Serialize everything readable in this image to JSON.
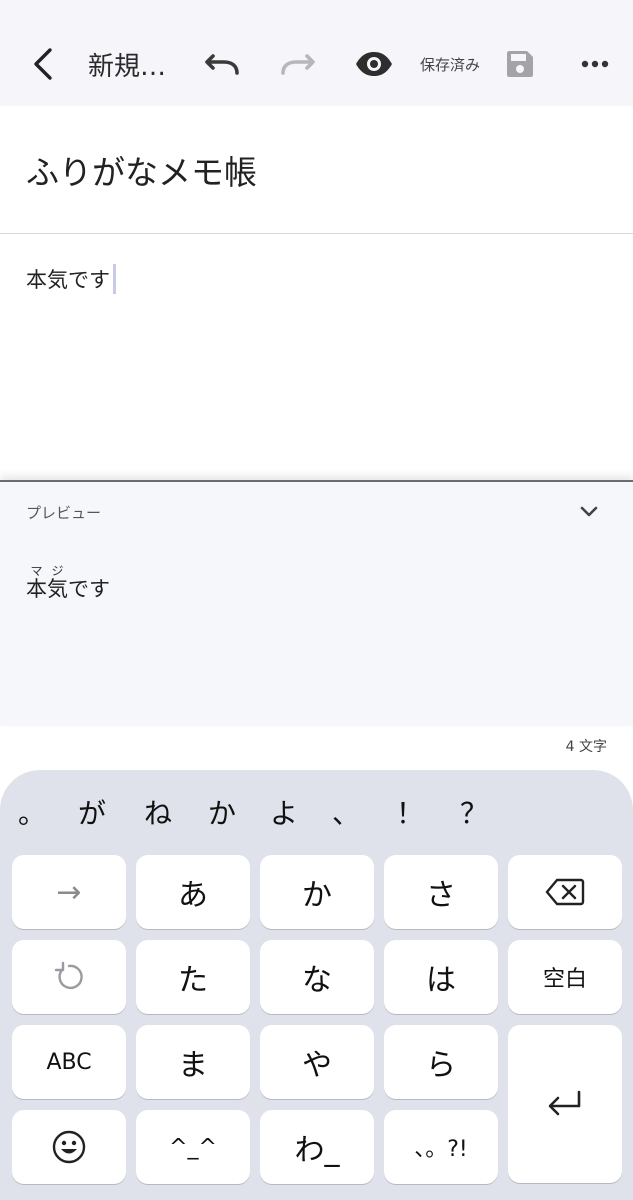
{
  "toolbar": {
    "back_icon": "chevron-left-icon",
    "doc_title": "新規…",
    "undo_icon": "undo-icon",
    "redo_icon": "redo-icon",
    "preview_icon": "eye-icon",
    "saved_status": "保存済み",
    "save_icon": "floppy-disk-icon",
    "more_icon": "more-horizontal-icon"
  },
  "note": {
    "title": "ふりがなメモ帳",
    "body": "本気です"
  },
  "preview": {
    "label": "プレビュー",
    "ruby_base": "本気",
    "ruby_reading": "マジ",
    "trailing": "です"
  },
  "char_count": "4 文字",
  "keyboard": {
    "suggestions": [
      "。",
      "が",
      "ね",
      "か",
      "よ",
      "、",
      "！",
      "？"
    ],
    "keys": {
      "next": "→",
      "a": "あ",
      "ka": "か",
      "sa": "さ",
      "ta": "た",
      "na": "な",
      "ha": "は",
      "space": "空白",
      "abc": "ABC",
      "ma": "ま",
      "ya": "や",
      "ra": "ら",
      "kaomoji": "^_^",
      "wa": "わ_",
      "punct": "、。?!"
    },
    "colors": {
      "background": "#dfe2ea",
      "key": "#ffffff"
    }
  }
}
